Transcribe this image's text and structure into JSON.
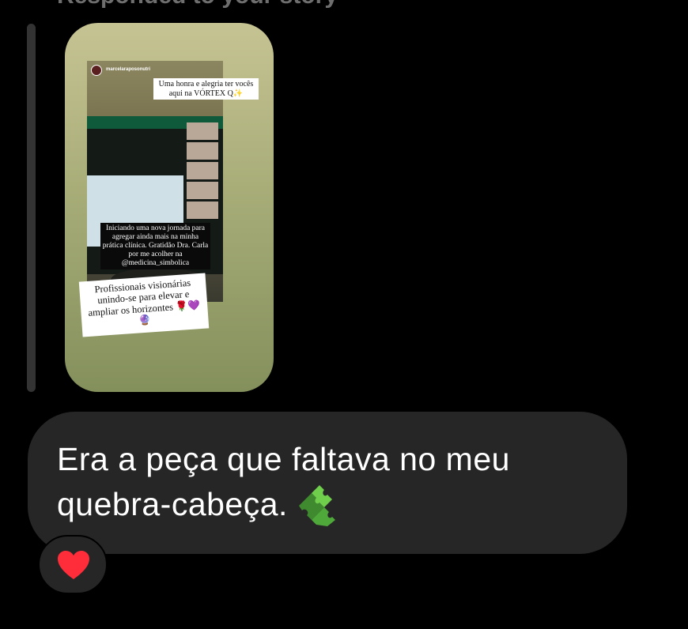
{
  "header": {
    "text": "Responded to your story"
  },
  "story": {
    "username": "marcelaraposonutri",
    "caption_top": "Uma honra e alegria ter vocês aqui na VÓRTEX Q✨",
    "caption_middle": "Iniciando uma nova jornada para agregar ainda mais na minha prática clínica. Gratidão Dra. Carla por me acolher na @medicina_simbolica",
    "caption_bottom": "Profissionais visionárias unindo-se para elevar e ampliar os horizontes 🌹💜🔮"
  },
  "message": {
    "text": "Era a peça que faltava no meu quebra-cabeça."
  },
  "reaction": {
    "icon": "heart-icon",
    "color": "#ff2d3a"
  },
  "colors": {
    "bubble": "#262626",
    "background": "#000000"
  }
}
